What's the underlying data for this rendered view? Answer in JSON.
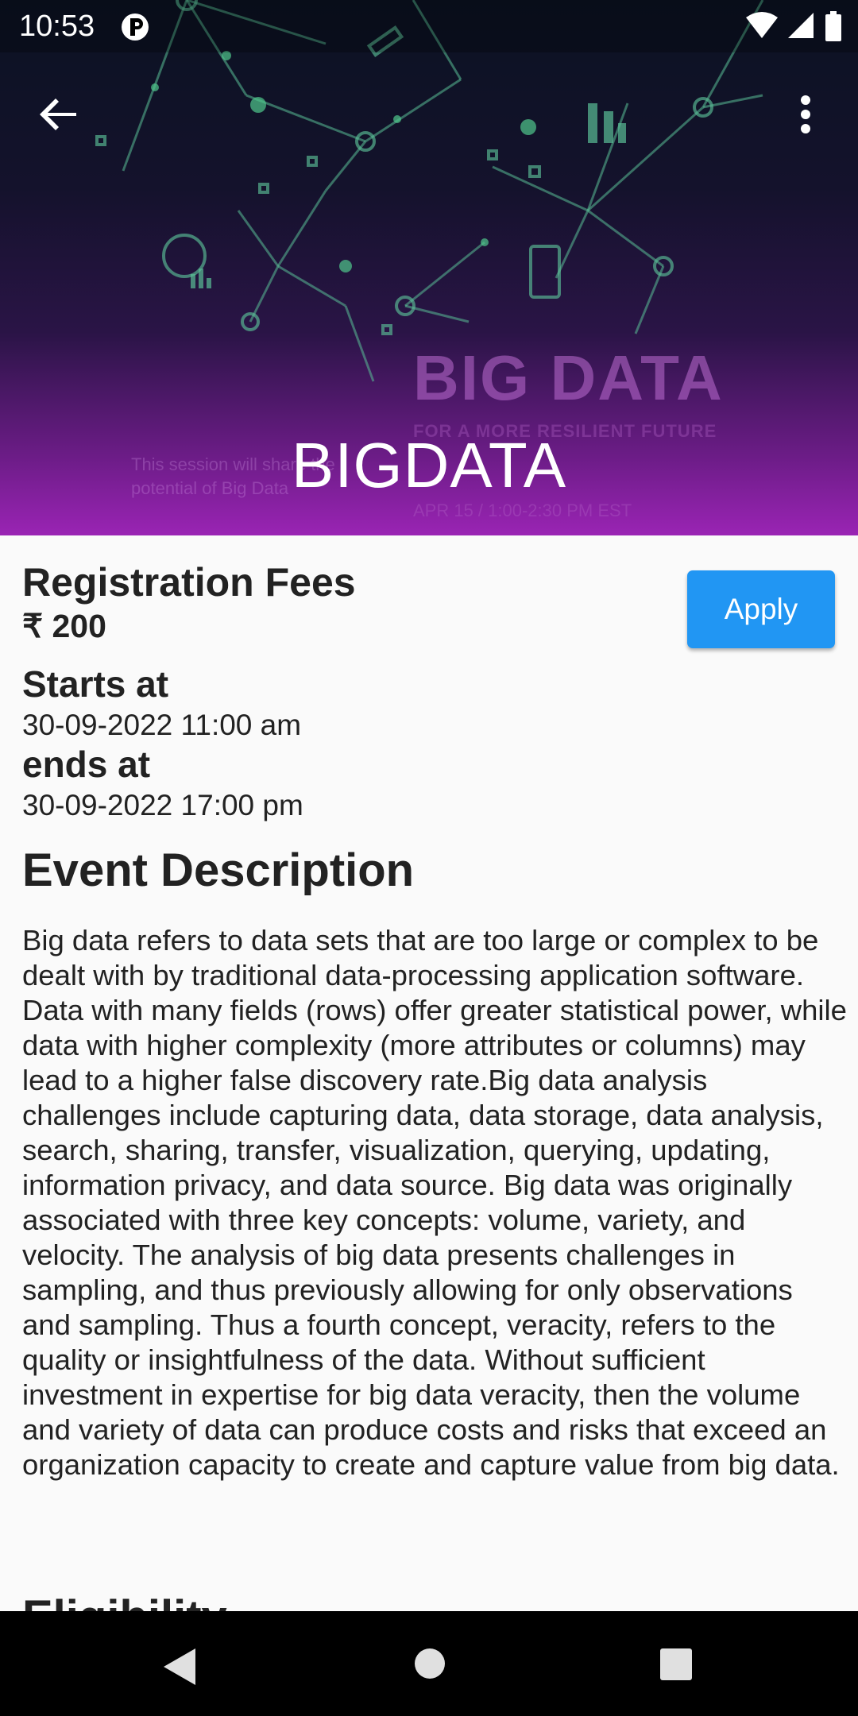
{
  "status_bar": {
    "time": "10:53",
    "icons": [
      "app-notification-icon",
      "wifi-icon",
      "cellular-signal-icon",
      "battery-icon"
    ]
  },
  "toolbar": {
    "back_icon": "arrow-left-icon",
    "menu_icon": "more-vertical-icon"
  },
  "hero": {
    "title": "BIGDATA",
    "banner_text": "BIG DATA",
    "banner_subtitle": "FOR A MORE RESILIENT FUTURE",
    "banner_date": "APR 15 / 1:00-2:30 PM EST",
    "banner_faded_text": "This session will share the potential of Big Data"
  },
  "registration": {
    "label": "Registration Fees",
    "fee": "₹ 200",
    "apply_label": "Apply"
  },
  "schedule": {
    "starts_label": "Starts at",
    "starts_value": "30-09-2022 11:00 am",
    "ends_label": "ends at",
    "ends_value": "30-09-2022 17:00 pm"
  },
  "description": {
    "heading": "Event Description",
    "text": "Big data refers to data sets that are too large or complex to be dealt with by traditional data-processing application software. Data with many fields (rows) offer greater statistical power, while data with higher complexity (more attributes or columns) may lead to a higher false discovery rate.Big data analysis challenges include capturing data, data storage, data analysis, search, sharing, transfer, visualization, querying, updating, information privacy, and data source. Big data was originally associated with three key concepts: volume, variety, and velocity. The analysis of big data presents challenges in sampling, and thus previously allowing for only observations and sampling. Thus a fourth concept, veracity, refers to the quality or insightfulness of the data. Without sufficient investment in expertise for big data veracity, then the volume and variety of data can produce costs and risks that exceed an organization capacity to create and capture value from big data."
  },
  "next_section": {
    "heading": "Eligibility"
  },
  "nav_bar": {
    "icons": [
      "nav-back-icon",
      "nav-home-icon",
      "nav-recents-icon"
    ]
  },
  "colors": {
    "accent": "#2196f3",
    "hero_gradient_end": "#9a24b4",
    "hero_gradient_start": "#0b1222"
  }
}
